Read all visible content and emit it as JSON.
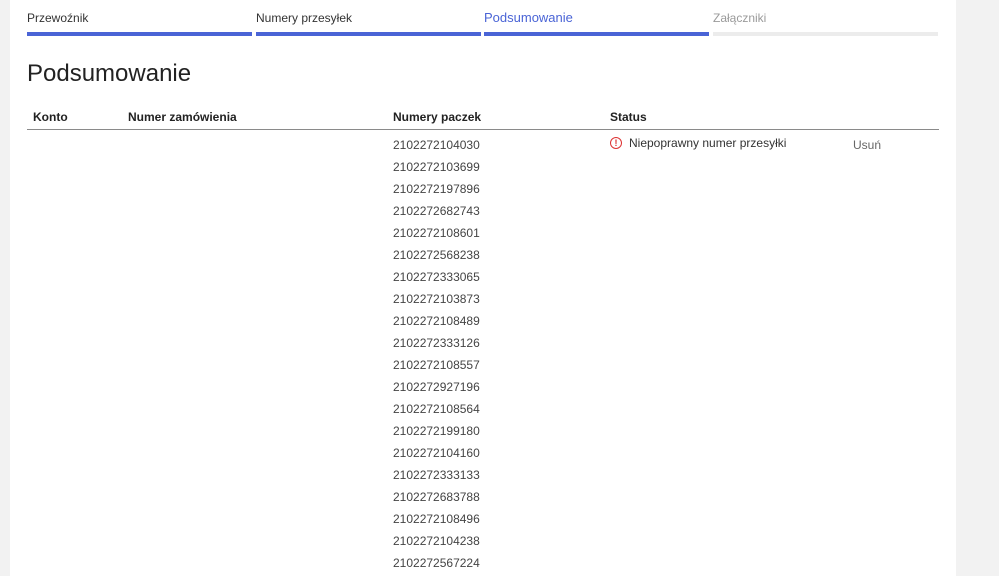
{
  "stepper": {
    "steps": [
      {
        "label": "Przewoźnik",
        "state": "done"
      },
      {
        "label": "Numery przesyłek",
        "state": "done"
      },
      {
        "label": "Podsumowanie",
        "state": "active"
      },
      {
        "label": "Załączniki",
        "state": "upcoming"
      }
    ],
    "active_color": "#4a64d6"
  },
  "page": {
    "title": "Podsumowanie"
  },
  "table": {
    "headers": {
      "konto": "Konto",
      "numer_zamowienia": "Numer zamówienia",
      "numery_paczek": "Numery paczek",
      "status": "Status"
    },
    "status": {
      "icon": "error-icon",
      "text": "Niepoprawny numer przesyłki",
      "color": "#d33333"
    },
    "delete_label": "Usuń",
    "rows": [
      "2102272104030",
      "2102272103699",
      "2102272197896",
      "2102272682743",
      "2102272108601",
      "2102272568238",
      "2102272333065",
      "2102272103873",
      "2102272108489",
      "2102272333126",
      "2102272108557",
      "2102272927196",
      "2102272108564",
      "2102272199180",
      "2102272104160",
      "2102272333133",
      "2102272683788",
      "2102272108496",
      "2102272104238",
      "2102272567224"
    ]
  }
}
